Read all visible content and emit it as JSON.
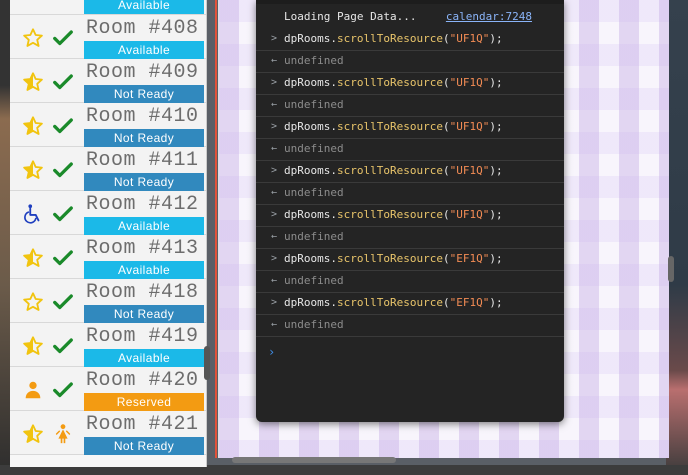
{
  "rooms": [
    {
      "name": "",
      "status": "Available",
      "status_type": "available",
      "type_icon": "star-outline-icon",
      "check_icon": "checkmark-icon"
    },
    {
      "name": "Room #408",
      "status": "Available",
      "status_type": "available",
      "type_icon": "star-outline-icon",
      "check_icon": "checkmark-icon"
    },
    {
      "name": "Room #409",
      "status": "Not Ready",
      "status_type": "notready",
      "type_icon": "star-half-icon",
      "check_icon": "checkmark-icon"
    },
    {
      "name": "Room #410",
      "status": "Not Ready",
      "status_type": "notready",
      "type_icon": "star-half-icon",
      "check_icon": "checkmark-icon"
    },
    {
      "name": "Room #411",
      "status": "Not Ready",
      "status_type": "notready",
      "type_icon": "star-half-icon",
      "check_icon": "checkmark-icon"
    },
    {
      "name": "Room #412",
      "status": "Available",
      "status_type": "available",
      "type_icon": "wheelchair-icon",
      "check_icon": "checkmark-icon"
    },
    {
      "name": "Room #413",
      "status": "Available",
      "status_type": "available",
      "type_icon": "star-half-icon",
      "check_icon": "checkmark-icon"
    },
    {
      "name": "Room #418",
      "status": "Not Ready",
      "status_type": "notready",
      "type_icon": "star-outline-icon",
      "check_icon": "checkmark-icon"
    },
    {
      "name": "Room #419",
      "status": "Available",
      "status_type": "available",
      "type_icon": "star-half-icon",
      "check_icon": "checkmark-icon"
    },
    {
      "name": "Room #420",
      "status": "Reserved",
      "status_type": "reserved",
      "type_icon": "person-icon",
      "check_icon": "checkmark-icon"
    },
    {
      "name": "Room #421",
      "status": "Not Ready",
      "status_type": "notready",
      "type_icon": "star-half-icon",
      "check_icon": "child-icon"
    }
  ],
  "console": {
    "header": {
      "text": "Loading Page Data...",
      "link": "calendar:7248"
    },
    "commands": [
      {
        "object": "dpRooms",
        "method": "scrollToResource",
        "arg": "\"UF1Q\"",
        "result": "undefined"
      },
      {
        "object": "dpRooms",
        "method": "scrollToResource",
        "arg": "\"UF1Q\"",
        "result": "undefined"
      },
      {
        "object": "dpRooms",
        "method": "scrollToResource",
        "arg": "\"UF1Q\"",
        "result": "undefined"
      },
      {
        "object": "dpRooms",
        "method": "scrollToResource",
        "arg": "\"UF1Q\"",
        "result": "undefined"
      },
      {
        "object": "dpRooms",
        "method": "scrollToResource",
        "arg": "\"UF1Q\"",
        "result": "undefined"
      },
      {
        "object": "dpRooms",
        "method": "scrollToResource",
        "arg": "\"EF1Q\"",
        "result": "undefined"
      },
      {
        "object": "dpRooms",
        "method": "scrollToResource",
        "arg": "\"EF1Q\"",
        "result": "undefined"
      }
    ]
  },
  "colors": {
    "available": "#1bb9e8",
    "notready": "#3189be",
    "reserved": "#f39b12",
    "star": "#f1c40f",
    "check": "#1a8a2a",
    "wheelchair": "#1f3fbf",
    "person": "#f39b12"
  }
}
